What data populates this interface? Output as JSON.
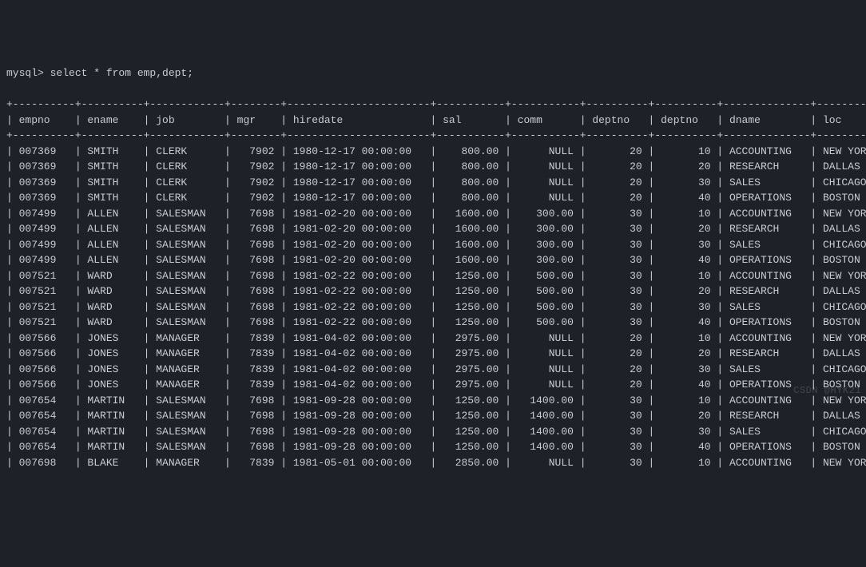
{
  "prompt": "mysql> select * from emp,dept;",
  "columns": [
    {
      "name": "empno",
      "width": 8,
      "align": "left"
    },
    {
      "name": "ename",
      "width": 8,
      "align": "left"
    },
    {
      "name": "job",
      "width": 10,
      "align": "left"
    },
    {
      "name": "mgr",
      "width": 6,
      "align": "right"
    },
    {
      "name": "hiredate",
      "width": 21,
      "align": "left"
    },
    {
      "name": "sal",
      "width": 9,
      "align": "right"
    },
    {
      "name": "comm",
      "width": 9,
      "align": "right"
    },
    {
      "name": "deptno",
      "width": 8,
      "align": "right"
    },
    {
      "name": "deptno",
      "width": 8,
      "align": "right"
    },
    {
      "name": "dname",
      "width": 12,
      "align": "left"
    },
    {
      "name": "loc",
      "width": 10,
      "align": "left"
    }
  ],
  "rows": [
    [
      "007369",
      "SMITH",
      "CLERK",
      "7902",
      "1980-12-17 00:00:00",
      "800.00",
      "NULL",
      "20",
      "10",
      "ACCOUNTING",
      "NEW YORK"
    ],
    [
      "007369",
      "SMITH",
      "CLERK",
      "7902",
      "1980-12-17 00:00:00",
      "800.00",
      "NULL",
      "20",
      "20",
      "RESEARCH",
      "DALLAS"
    ],
    [
      "007369",
      "SMITH",
      "CLERK",
      "7902",
      "1980-12-17 00:00:00",
      "800.00",
      "NULL",
      "20",
      "30",
      "SALES",
      "CHICAGO"
    ],
    [
      "007369",
      "SMITH",
      "CLERK",
      "7902",
      "1980-12-17 00:00:00",
      "800.00",
      "NULL",
      "20",
      "40",
      "OPERATIONS",
      "BOSTON"
    ],
    [
      "007499",
      "ALLEN",
      "SALESMAN",
      "7698",
      "1981-02-20 00:00:00",
      "1600.00",
      "300.00",
      "30",
      "10",
      "ACCOUNTING",
      "NEW YORK"
    ],
    [
      "007499",
      "ALLEN",
      "SALESMAN",
      "7698",
      "1981-02-20 00:00:00",
      "1600.00",
      "300.00",
      "30",
      "20",
      "RESEARCH",
      "DALLAS"
    ],
    [
      "007499",
      "ALLEN",
      "SALESMAN",
      "7698",
      "1981-02-20 00:00:00",
      "1600.00",
      "300.00",
      "30",
      "30",
      "SALES",
      "CHICAGO"
    ],
    [
      "007499",
      "ALLEN",
      "SALESMAN",
      "7698",
      "1981-02-20 00:00:00",
      "1600.00",
      "300.00",
      "30",
      "40",
      "OPERATIONS",
      "BOSTON"
    ],
    [
      "007521",
      "WARD",
      "SALESMAN",
      "7698",
      "1981-02-22 00:00:00",
      "1250.00",
      "500.00",
      "30",
      "10",
      "ACCOUNTING",
      "NEW YORK"
    ],
    [
      "007521",
      "WARD",
      "SALESMAN",
      "7698",
      "1981-02-22 00:00:00",
      "1250.00",
      "500.00",
      "30",
      "20",
      "RESEARCH",
      "DALLAS"
    ],
    [
      "007521",
      "WARD",
      "SALESMAN",
      "7698",
      "1981-02-22 00:00:00",
      "1250.00",
      "500.00",
      "30",
      "30",
      "SALES",
      "CHICAGO"
    ],
    [
      "007521",
      "WARD",
      "SALESMAN",
      "7698",
      "1981-02-22 00:00:00",
      "1250.00",
      "500.00",
      "30",
      "40",
      "OPERATIONS",
      "BOSTON"
    ],
    [
      "007566",
      "JONES",
      "MANAGER",
      "7839",
      "1981-04-02 00:00:00",
      "2975.00",
      "NULL",
      "20",
      "10",
      "ACCOUNTING",
      "NEW YORK"
    ],
    [
      "007566",
      "JONES",
      "MANAGER",
      "7839",
      "1981-04-02 00:00:00",
      "2975.00",
      "NULL",
      "20",
      "20",
      "RESEARCH",
      "DALLAS"
    ],
    [
      "007566",
      "JONES",
      "MANAGER",
      "7839",
      "1981-04-02 00:00:00",
      "2975.00",
      "NULL",
      "20",
      "30",
      "SALES",
      "CHICAGO"
    ],
    [
      "007566",
      "JONES",
      "MANAGER",
      "7839",
      "1981-04-02 00:00:00",
      "2975.00",
      "NULL",
      "20",
      "40",
      "OPERATIONS",
      "BOSTON"
    ],
    [
      "007654",
      "MARTIN",
      "SALESMAN",
      "7698",
      "1981-09-28 00:00:00",
      "1250.00",
      "1400.00",
      "30",
      "10",
      "ACCOUNTING",
      "NEW YORK"
    ],
    [
      "007654",
      "MARTIN",
      "SALESMAN",
      "7698",
      "1981-09-28 00:00:00",
      "1250.00",
      "1400.00",
      "30",
      "20",
      "RESEARCH",
      "DALLAS"
    ],
    [
      "007654",
      "MARTIN",
      "SALESMAN",
      "7698",
      "1981-09-28 00:00:00",
      "1250.00",
      "1400.00",
      "30",
      "30",
      "SALES",
      "CHICAGO"
    ],
    [
      "007654",
      "MARTIN",
      "SALESMAN",
      "7698",
      "1981-09-28 00:00:00",
      "1250.00",
      "1400.00",
      "30",
      "40",
      "OPERATIONS",
      "BOSTON"
    ],
    [
      "007698",
      "BLAKE",
      "MANAGER",
      "7839",
      "1981-05-01 00:00:00",
      "2850.00",
      "NULL",
      "30",
      "10",
      "ACCOUNTING",
      "NEW YORK"
    ]
  ],
  "watermark": "CSDN @HYK21"
}
